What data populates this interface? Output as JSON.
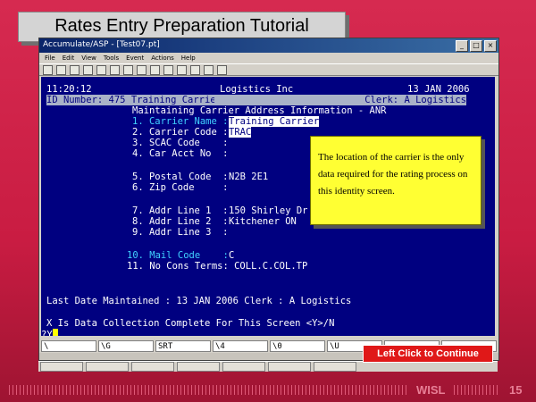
{
  "slide": {
    "title": "Rates Entry Preparation Tutorial",
    "footer_label": "WISL",
    "page_number": "15",
    "continue_button": "Left Click to Continue"
  },
  "window": {
    "title": "Accumulate/ASP - [Test07.pt]",
    "controls": [
      "_",
      "□",
      "×"
    ],
    "menu": [
      "File",
      "Edit",
      "View",
      "Tools",
      "Event",
      "Actions",
      "Help"
    ]
  },
  "terminal": {
    "time": "11:20:12",
    "company": "Logistics Inc",
    "date": "13 JAN 2006",
    "id_line": "ID Number: 475 Training Carrier",
    "clerk": "Clerk: A Logistics",
    "heading": "Maintaining Carrier Address Information - ANR",
    "fields": {
      "f1_label": "1. Carrier Name :",
      "f1_value": "Training Carrier",
      "f2_label": "2. Carrier Code :",
      "f2_value": "TRAC",
      "f3": "3. SCAC Code    :",
      "f4": "4. Car Acct No  :",
      "f5_label": "5. Postal Code  :",
      "f5_value": "N2B 2E1",
      "f6": "6. Zip Code     :",
      "f7_label": "7. Addr Line 1  :",
      "f7_value": "150 Shirley Dr",
      "f8_label": "8. Addr Line 2  :",
      "f8_value": "Kitchener ON",
      "f9": "9. Addr Line 3  :",
      "f10_label": "10. Mail Code    :",
      "f10_value": "C",
      "f11": "11. No Cons Terms: COLL.C.COL.TP"
    },
    "last_maintained": "Last Date Maintained : 13 JAN 2006 Clerk : A Logistics",
    "prompt": "X Is Data Collection Complete For This Screen <Y>/N",
    "input": "?Y"
  },
  "fkeys": [
    "\\",
    "\\G",
    "SRT",
    "\\4",
    "\\0",
    "\\U",
    "",
    ""
  ],
  "callout": {
    "text": "The location of the carrier is the only data required for the rating process on this identity screen."
  }
}
